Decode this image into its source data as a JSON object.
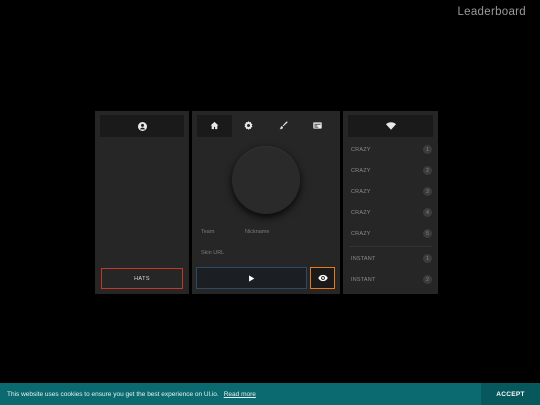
{
  "header": {
    "leaderboard_label": "Leaderboard"
  },
  "left_panel": {
    "tab_icon": "user-icon",
    "hats_label": "HATS"
  },
  "center_panel": {
    "tabs": [
      {
        "icon": "home-icon",
        "active": true
      },
      {
        "icon": "gear-icon",
        "active": false
      },
      {
        "icon": "brush-icon",
        "active": false
      },
      {
        "icon": "id-card-icon",
        "active": false
      }
    ],
    "team_placeholder": "Team",
    "nickname_placeholder": "Nickname",
    "skin_url_placeholder": "Skin URL",
    "play_icon": "play-icon",
    "spectate_icon": "eye-icon"
  },
  "right_panel": {
    "tab_icon": "wifi-icon",
    "servers": [
      {
        "name": "CRAZY",
        "count": "1"
      },
      {
        "name": "CRAZY",
        "count": "2"
      },
      {
        "name": "CRAZY",
        "count": "3"
      },
      {
        "name": "CRAZY",
        "count": "4"
      },
      {
        "name": "CRAZY",
        "count": "5"
      },
      {
        "name": "INSTANT",
        "count": "1"
      },
      {
        "name": "INSTANT",
        "count": "2"
      }
    ]
  },
  "cookie_bar": {
    "message": "This website uses cookies to ensure you get the best experience on Ul.io.",
    "read_more": "Read more",
    "accept": "ACCEPT"
  },
  "colors": {
    "accent_red": "#c0392b",
    "accent_orange": "#e6781e",
    "accent_blue": "#2c4a66",
    "cookie_bg": "#0a6a6f"
  }
}
